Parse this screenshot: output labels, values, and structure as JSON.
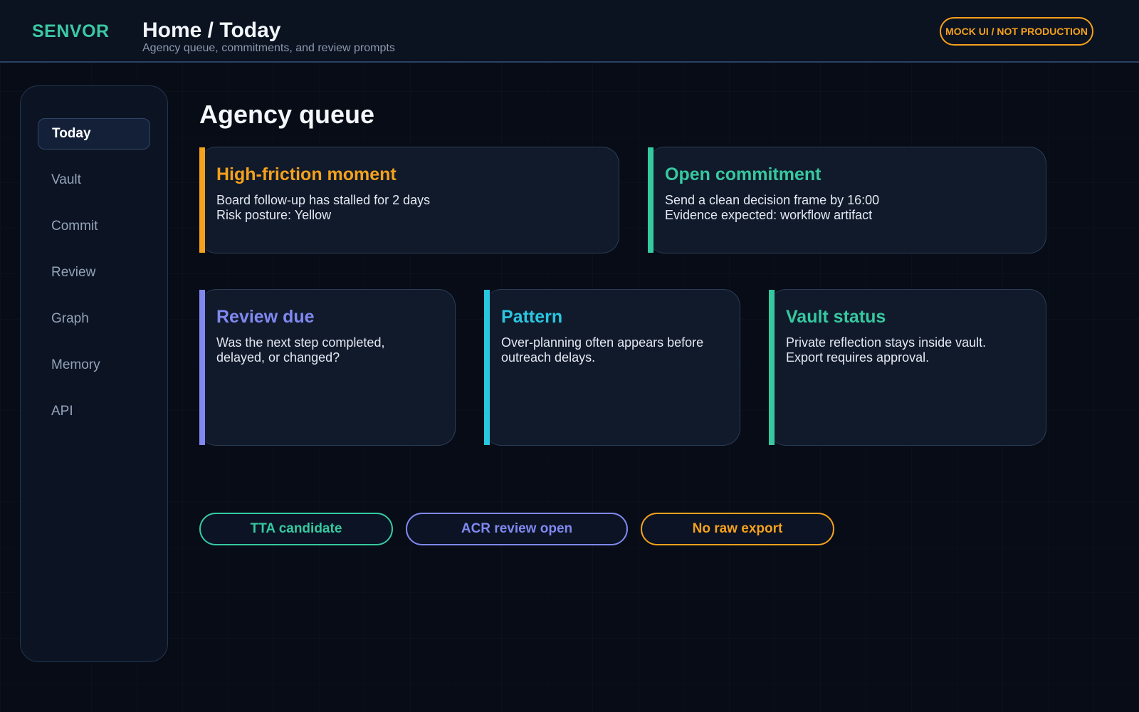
{
  "header": {
    "brand": "SENVOR",
    "breadcrumb": "Home / Today",
    "subtitle": "Agency queue, commitments, and review prompts",
    "badge": "MOCK UI / NOT PRODUCTION"
  },
  "sidebar": {
    "items": [
      {
        "label": "Today",
        "active": true
      },
      {
        "label": "Vault"
      },
      {
        "label": "Commit"
      },
      {
        "label": "Review"
      },
      {
        "label": "Graph"
      },
      {
        "label": "Memory"
      },
      {
        "label": "API"
      }
    ]
  },
  "main": {
    "title": "Agency queue",
    "cards": [
      {
        "title": "High-friction moment",
        "lines": [
          "Board follow-up has stalled for 2 days",
          "Risk posture: Yellow"
        ],
        "color": "#f5a11c"
      },
      {
        "title": "Open commitment",
        "lines": [
          "Send a clean decision frame by 16:00",
          "Evidence expected: workflow artifact"
        ],
        "color": "#36c9a0"
      },
      {
        "title": "Review due",
        "lines": [
          "Was the next step completed,",
          "delayed, or changed?"
        ],
        "color": "#8088f0"
      },
      {
        "title": "Pattern",
        "lines": [
          "Over-planning often appears before",
          "outreach delays."
        ],
        "color": "#29c6e0"
      },
      {
        "title": "Vault status",
        "lines": [
          "Private reflection stays inside vault.",
          "Export requires approval."
        ],
        "color": "#36c9a0"
      }
    ],
    "tags": [
      {
        "label": "TTA candidate",
        "color": "#36c9a0"
      },
      {
        "label": "ACR review open",
        "color": "#8088f0"
      },
      {
        "label": "No raw export",
        "color": "#f5a11c"
      }
    ]
  }
}
